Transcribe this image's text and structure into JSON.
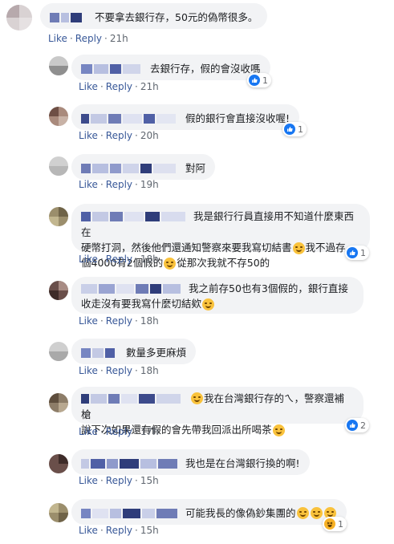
{
  "comments": [
    {
      "text": "不要拿去銀行存，50元的偽幣很多。",
      "like": "Like",
      "reply": "Reply",
      "time": "21h"
    },
    {
      "text": "去銀行存，假的會沒收嗎",
      "like": "Like",
      "reply": "Reply",
      "time": "21h",
      "reactions": "1"
    },
    {
      "text": "假的銀行會直接沒收喔!",
      "like": "Like",
      "reply": "Reply",
      "time": "20h",
      "reactions": "1"
    },
    {
      "text": "對阿",
      "like": "Like",
      "reply": "Reply",
      "time": "19h"
    },
    {
      "line1": "我是銀行行員直接用不知道什麼東西在",
      "line2a": "硬幣打洞，然後他們還通知警察來要我寫切結書",
      "line2b": "我不過存",
      "line3a": "個4000有2個假的",
      "line3b": "從那次我就不存50的",
      "like": "Like",
      "reply": "Reply",
      "time": "18h",
      "reactions": "1"
    },
    {
      "line1": "我之前存50也有3個假的，銀行直接",
      "line2": "收走沒有要我寫什麼切結欸",
      "like": "Like",
      "reply": "Reply",
      "time": "18h"
    },
    {
      "text": "數量多更麻煩",
      "like": "Like",
      "reply": "Reply",
      "time": "18h"
    },
    {
      "line1": "我在台灣銀行存的ㄟ，警察還補槍",
      "line2": "說下次如果還有假的會先帶我回派出所喝茶",
      "like": "Like",
      "reply": "Reply",
      "time": "17h",
      "reactions": "2"
    },
    {
      "text": "我也是在台灣銀行換的啊!",
      "like": "Like",
      "reply": "Reply",
      "time": "15h"
    },
    {
      "text": "可能我長的像偽鈔集團的",
      "like": "Like",
      "reply": "Reply",
      "time": "15h",
      "reactions": "1"
    }
  ],
  "icons": {
    "like": "like-icon",
    "haha": "haha-icon",
    "emoji": "smiling-emoji"
  },
  "colors": {
    "link": "#385898",
    "bubble": "#f2f3f5",
    "like_blue": "#1877f2"
  }
}
